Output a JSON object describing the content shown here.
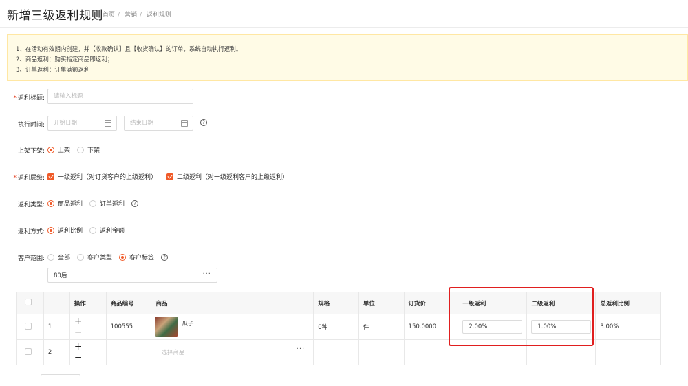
{
  "header": {
    "title": "新增三级返利规则",
    "breadcrumb": [
      "首页",
      "营销",
      "返利规则"
    ]
  },
  "notice": [
    "1、在活动有效期内创建，并【收款确认】且【收货确认】的订单，系统自动执行返利。",
    "2、商品返利：购买指定商品即返利；",
    "3、订单返利：订单满额返利"
  ],
  "form": {
    "title_label": "返利标题:",
    "title_placeholder": "请输入标题",
    "time_label": "执行时间:",
    "start_placeholder": "开始日期",
    "end_placeholder": "结束日期",
    "shelf_label": "上架下架:",
    "shelf_options": [
      "上架",
      "下架"
    ],
    "level_label": "返利层级:",
    "level_options": [
      "一级返利（对订货客户的上级返利）",
      "二级返利（对一级返利客户的上级返利）"
    ],
    "type_label": "返利类型:",
    "type_options": [
      "商品返利",
      "订单返利"
    ],
    "mode_label": "返利方式:",
    "mode_options": [
      "返利比例",
      "返利金额"
    ],
    "scope_label": "客户范围:",
    "scope_options": [
      "全部",
      "客户类型",
      "客户标签"
    ],
    "tag_value": "80后"
  },
  "table": {
    "headers": [
      "",
      "",
      "操作",
      "商品编号",
      "商品",
      "规格",
      "单位",
      "订货价",
      "一级返利",
      "二级返利",
      "总返利比例"
    ],
    "rows": [
      {
        "index": "1",
        "code": "100555",
        "product": "瓜子",
        "spec": "0种",
        "unit": "件",
        "price": "150.0000",
        "level1": "2.00%",
        "level2": "1.00%",
        "total": "3.00%"
      },
      {
        "index": "2",
        "product_placeholder": "选择商品"
      }
    ]
  },
  "icons": {
    "plus": "+",
    "minus": "−",
    "dots": "···",
    "help": "?"
  },
  "colors": {
    "accent": "#f05a28",
    "highlight": "#e01f1f",
    "notice_bg": "#fffbe6"
  }
}
